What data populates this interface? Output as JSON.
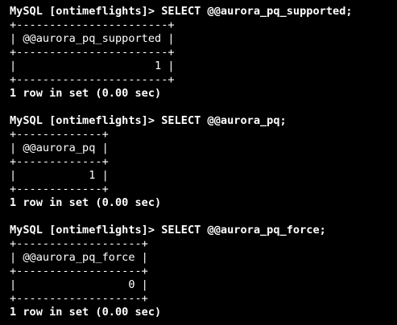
{
  "terminal": {
    "blocks": [
      {
        "prompt": "MySQL [ontimeflights]> SELECT @@aurora_pq_supported;",
        "border": "+-----------------------+",
        "header": "| @@aurora_pq_supported |",
        "value_row": "|                     1 |",
        "status": "1 row in set (0.00 sec)"
      },
      {
        "prompt": "MySQL [ontimeflights]> SELECT @@aurora_pq;",
        "border": "+-------------+",
        "header": "| @@aurora_pq |",
        "value_row": "|           1 |",
        "status": "1 row in set (0.00 sec)"
      },
      {
        "prompt": "MySQL [ontimeflights]> SELECT @@aurora_pq_force;",
        "border": "+-------------------+",
        "header": "| @@aurora_pq_force |",
        "value_row": "|                 0 |",
        "status": "1 row in set (0.00 sec)"
      }
    ]
  },
  "colors": {
    "background": "#000000",
    "text": "#ffffff"
  }
}
